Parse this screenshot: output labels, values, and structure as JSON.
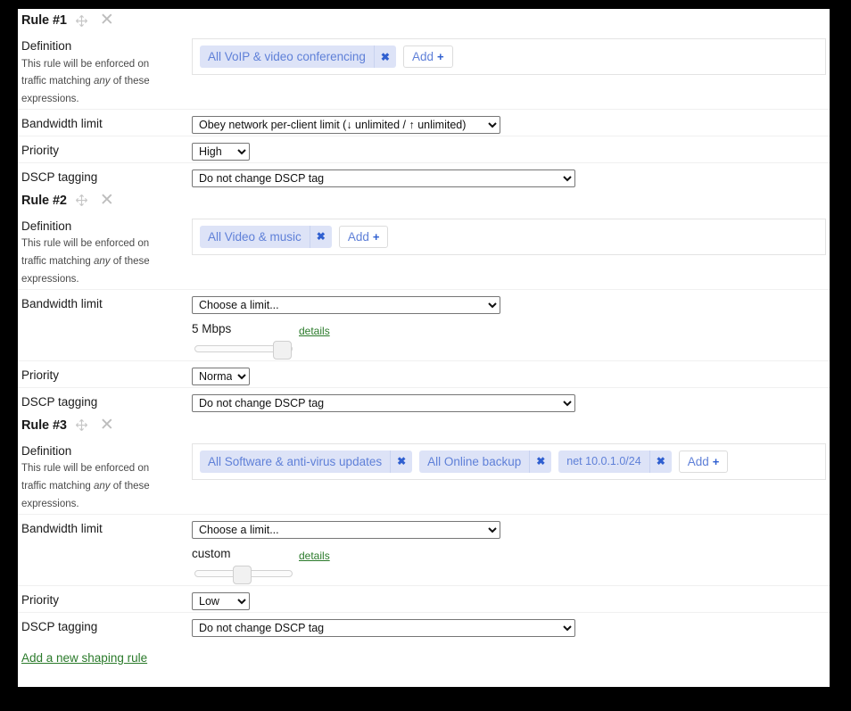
{
  "labels": {
    "definition": "Definition",
    "definition_help_a": "This rule will be enforced on traffic matching ",
    "definition_help_any": "any",
    "definition_help_b": " of these expressions.",
    "bandwidth_limit": "Bandwidth limit",
    "priority": "Priority",
    "dscp_tagging": "DSCP tagging",
    "add": "Add",
    "add_plus": "+",
    "details": "details",
    "remove_tag": "✖",
    "close": "✕"
  },
  "colors": {
    "tag_bg": "#dde3f7",
    "tag_text": "#5f80d8",
    "link_green": "#2a7a2a",
    "page_bg": "#ffffff",
    "letterbox": "#000000"
  },
  "footer": {
    "add_rule_link": "Add a new shaping rule"
  },
  "rules": [
    {
      "title": "Rule #1",
      "tags": [
        {
          "text": "All VoIP & video conferencing",
          "mono": false
        }
      ],
      "bandwidth_limit": "Obey network per-client limit (↓ unlimited / ↑ unlimited)",
      "has_slider": false,
      "limit_value": "",
      "slider_percent": 0,
      "priority": "High",
      "dscp": "Do not change DSCP tag"
    },
    {
      "title": "Rule #2",
      "tags": [
        {
          "text": "All Video & music",
          "mono": false
        }
      ],
      "bandwidth_limit": "Choose a limit...",
      "has_slider": true,
      "limit_value": "5 Mbps",
      "slider_percent": 100,
      "priority": "Normal",
      "dscp": "Do not change DSCP tag"
    },
    {
      "title": "Rule #3",
      "tags": [
        {
          "text": "All Software & anti-virus updates",
          "mono": false
        },
        {
          "text": "All Online backup",
          "mono": false
        },
        {
          "text": "net 10.0.1.0/24",
          "mono": true
        }
      ],
      "bandwidth_limit": "Choose a limit...",
      "has_slider": true,
      "limit_value": "custom",
      "slider_percent": 48,
      "priority": "Low",
      "dscp": "Do not change DSCP tag"
    }
  ]
}
